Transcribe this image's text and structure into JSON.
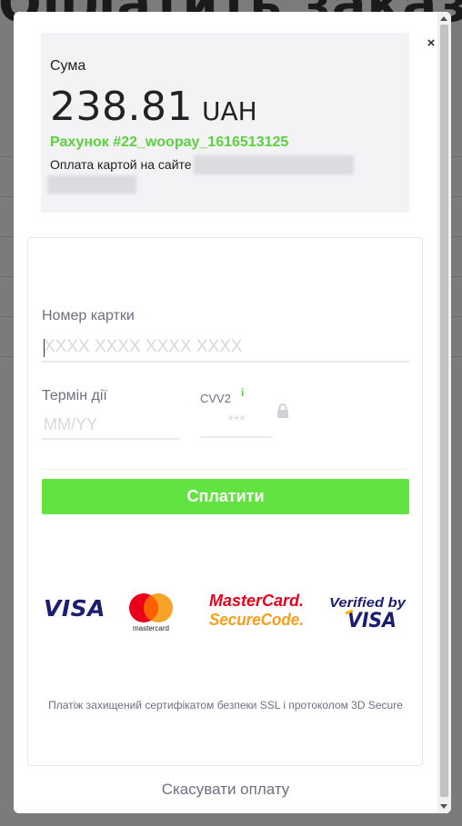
{
  "background": {
    "heading": "Оплатить заказ"
  },
  "modal": {
    "close_glyph": "×",
    "summary": {
      "amount_label": "Сума",
      "amount": "238.81",
      "currency": "UAH",
      "invoice": "Рахунок #22_woopay_1616513125",
      "description": "Оплата картой на сайте"
    },
    "form": {
      "card_number_label": "Номер картки",
      "card_number_placeholder": "XXXX XXXX XXXX XXXX",
      "expiry_label": "Термін дії",
      "expiry_placeholder": "MM/YY",
      "cvv_label": "CVV2",
      "cvv_info": "i",
      "cvv_placeholder": "***",
      "pay_button": "Сплатити"
    },
    "logos": {
      "visa": "VISA",
      "mastercard": "mastercard",
      "mc_securecode_line1": "MasterCard.",
      "mc_securecode_line2": "SecureCode.",
      "verified_by": "Verified by",
      "verified_visa": "VISA"
    },
    "security_note": "Платіж захищений сертифікатом безпеки SSL і протоколом 3D Secure",
    "cancel": "Скасувати оплату"
  },
  "colors": {
    "accent_green": "#62e342",
    "invoice_green": "#5cd03e",
    "visa_blue": "#1a1f71",
    "mc_red": "#eb001b",
    "mc_orange": "#f79e1b",
    "muted_text": "#6d6f85"
  },
  "icons": [
    "close-icon",
    "info-icon",
    "lock-icon",
    "visa-logo",
    "mastercard-logo",
    "mastercard-securecode-logo",
    "verified-by-visa-logo"
  ]
}
